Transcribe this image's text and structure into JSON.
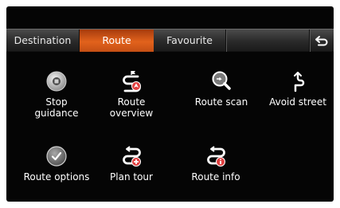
{
  "tabs": [
    {
      "label": "Destination",
      "active": false
    },
    {
      "label": "Route",
      "active": true
    },
    {
      "label": "Favourite",
      "active": false
    }
  ],
  "back_icon": "back-arrow-icon",
  "menu": [
    {
      "label": "Stop\nguidance",
      "icon": "stop-guidance-icon"
    },
    {
      "label": "Route\noverview",
      "icon": "route-overview-icon"
    },
    {
      "label": "Route scan",
      "icon": "route-scan-icon"
    },
    {
      "label": "Avoid street",
      "icon": "avoid-street-icon"
    },
    {
      "label": "Route options",
      "icon": "route-options-icon"
    },
    {
      "label": "Plan tour",
      "icon": "plan-tour-icon"
    },
    {
      "label": "Route info",
      "icon": "route-info-icon"
    }
  ],
  "colors": {
    "accent": "#e2621c",
    "background": "#050505",
    "text": "#ffffff"
  }
}
